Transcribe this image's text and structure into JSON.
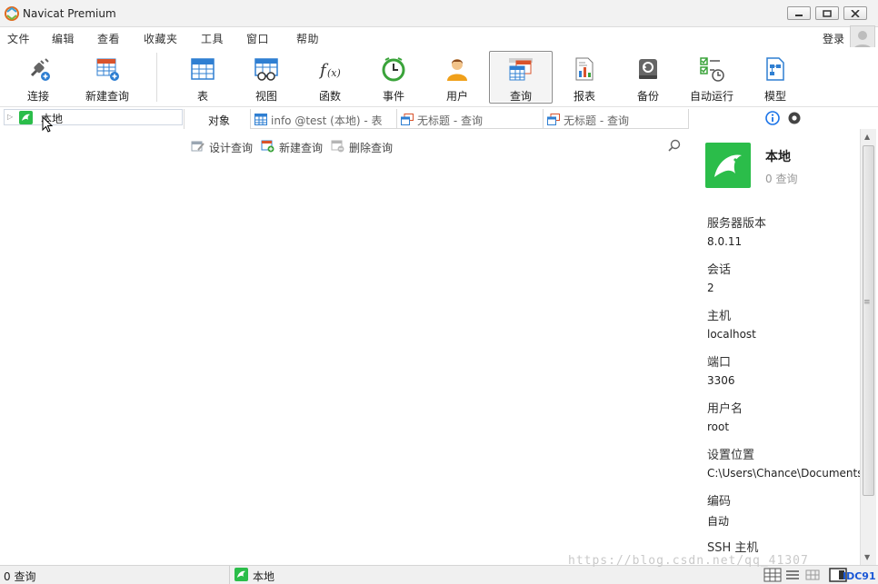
{
  "window": {
    "title": "Navicat Premium"
  },
  "menu": {
    "items": [
      "文件",
      "编辑",
      "查看",
      "收藏夹",
      "工具",
      "窗口",
      "帮助"
    ],
    "signin": "登录"
  },
  "toolbar": {
    "items": [
      {
        "label": "连接",
        "icon": "plug-icon"
      },
      {
        "label": "新建查询",
        "icon": "new-query-icon"
      },
      {
        "label": "表",
        "icon": "table-icon"
      },
      {
        "label": "视图",
        "icon": "view-icon"
      },
      {
        "label": "函数",
        "icon": "function-icon"
      },
      {
        "label": "事件",
        "icon": "clock-icon"
      },
      {
        "label": "用户",
        "icon": "user-icon"
      },
      {
        "label": "查询",
        "icon": "query-icon"
      },
      {
        "label": "报表",
        "icon": "report-icon"
      },
      {
        "label": "备份",
        "icon": "backup-icon"
      },
      {
        "label": "自动运行",
        "icon": "schedule-icon"
      },
      {
        "label": "模型",
        "icon": "model-icon"
      }
    ],
    "active": "查询"
  },
  "tree": {
    "items": [
      {
        "label": "本地",
        "icon": "mysql-dolphin-icon"
      }
    ]
  },
  "tabs": [
    {
      "label": "对象",
      "icon": ""
    },
    {
      "label": "info @test (本地) - 表",
      "icon": "table-icon"
    },
    {
      "label": "无标题 - 查询",
      "icon": "query-icon"
    },
    {
      "label": "无标题 - 查询",
      "icon": "query-icon"
    }
  ],
  "object_toolbar": {
    "design_query": "设计查询",
    "new_query": "新建查询",
    "delete_query": "删除查询"
  },
  "info_panel": {
    "name": "本地",
    "subtitle": "0 查询",
    "properties": [
      {
        "key": "服务器版本",
        "value": "8.0.11"
      },
      {
        "key": "会话",
        "value": "2"
      },
      {
        "key": "主机",
        "value": "localhost"
      },
      {
        "key": "端口",
        "value": "3306"
      },
      {
        "key": "用户名",
        "value": "root"
      },
      {
        "key": "设置位置",
        "value": "C:\\Users\\Chance\\Documents\\"
      },
      {
        "key": "编码",
        "value": "自动"
      },
      {
        "key": "SSH 主机",
        "value": ""
      }
    ]
  },
  "status": {
    "left": "0 查询",
    "connection": "本地",
    "watermark": "https://blog.csdn.net/qq_41307",
    "corner": "IDC91"
  },
  "colors": {
    "accent_green": "#2bbd4a",
    "info_blue": "#1a73e8"
  }
}
